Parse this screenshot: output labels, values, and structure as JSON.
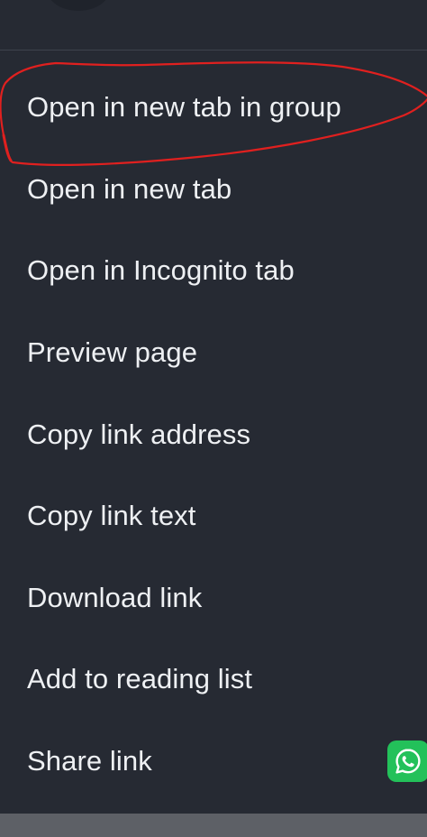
{
  "menu": {
    "items": [
      {
        "label": "Open in new tab in group"
      },
      {
        "label": "Open in new tab"
      },
      {
        "label": "Open in Incognito tab"
      },
      {
        "label": "Preview page"
      },
      {
        "label": "Copy link address"
      },
      {
        "label": "Copy link text"
      },
      {
        "label": "Download link"
      },
      {
        "label": "Add to reading list"
      },
      {
        "label": "Share link"
      }
    ]
  },
  "icons": {
    "share_app": "whatsapp-icon"
  },
  "colors": {
    "background": "#262a33",
    "text": "#eef0f3",
    "annotation": "#e0201f",
    "whatsapp": "#23c15a"
  }
}
